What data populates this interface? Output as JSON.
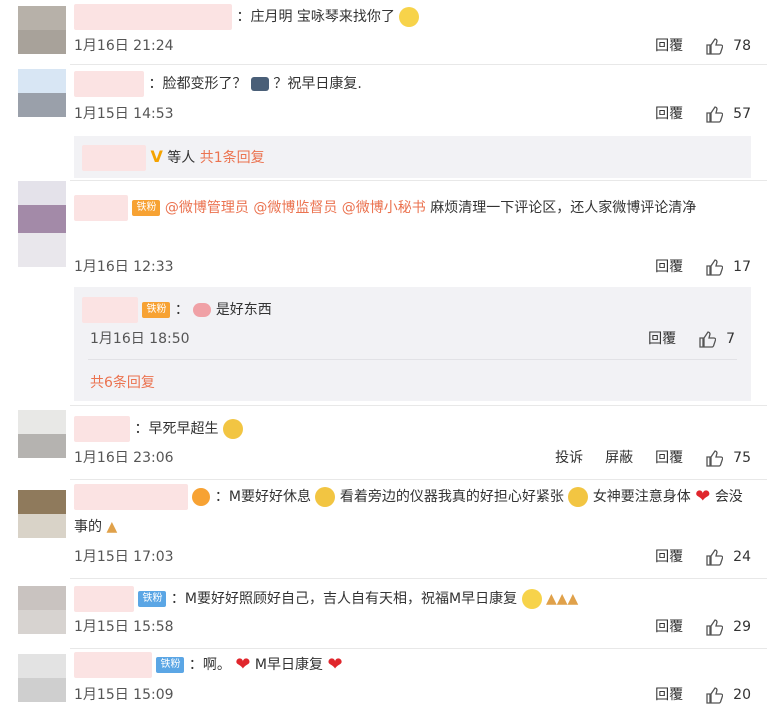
{
  "labels": {
    "reply": "回覆",
    "report": "投诉",
    "block": "屏蔽"
  },
  "comments": [
    {
      "text": "：庄月明 宝咏琴来找你了",
      "time": "1月16日 21:24",
      "likes": "78"
    },
    {
      "text_a": "：脸都变形了？",
      "text_b": "？祝早日康复.",
      "time": "1月15日 14:53",
      "likes": "57",
      "sub_summary": {
        "text": "等人",
        "link": "共1条回复"
      }
    },
    {
      "mentions": "@微博管理员 @微博监督员 @微博小秘书",
      "text": "麻烦清理一下评论区，还人家微博评论清净",
      "badge": "铁粉",
      "time": "1月16日 12:33",
      "likes": "17",
      "reply": {
        "badge": "铁粉",
        "text": "：",
        "text_b": "是好东西",
        "time": "1月16日 18:50",
        "likes": "7"
      },
      "more": "共6条回复"
    },
    {
      "text": "：早死早超生",
      "time": "1月16日 23:06",
      "likes": "75"
    },
    {
      "text_a": "：M要好好休息",
      "text_b": "看着旁边的仪器我真的好担心好紧张",
      "text_c": "女神要注意身体",
      "text_d": "会没事的",
      "time": "1月15日 17:03",
      "likes": "24"
    },
    {
      "badge": "铁粉",
      "text": "：M要好好照顾好自己，吉人自有天相，祝福M早日康复",
      "time": "1月15日 15:58",
      "likes": "29"
    },
    {
      "badge": "铁粉",
      "text_a": "：啊。",
      "text_b": "M早日康复",
      "time": "1月15日 15:09",
      "likes": "20"
    }
  ]
}
